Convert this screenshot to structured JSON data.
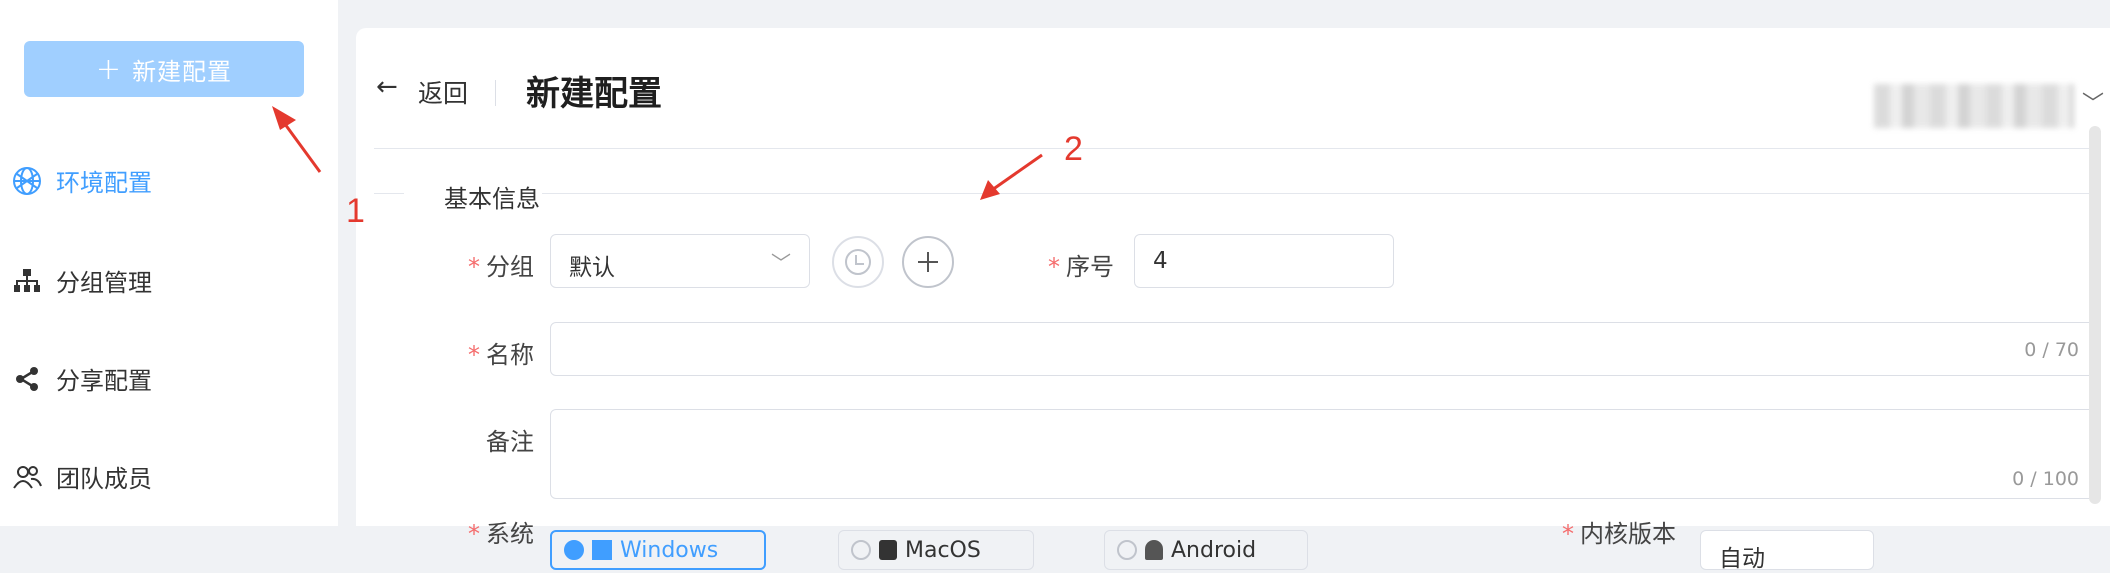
{
  "sidebar": {
    "new_button_label": "新建配置",
    "items": [
      {
        "label": "环境配置",
        "icon": "globe-icon",
        "active": true
      },
      {
        "label": "分组管理",
        "icon": "hierarchy-icon",
        "active": false
      },
      {
        "label": "分享配置",
        "icon": "share-icon",
        "active": false
      },
      {
        "label": "团队成员",
        "icon": "team-icon",
        "active": false
      }
    ]
  },
  "header": {
    "back_label": "返回",
    "title": "新建配置"
  },
  "form": {
    "section_title": "基本信息",
    "group": {
      "label": "分组",
      "value": "默认"
    },
    "serial": {
      "label": "序号",
      "value": "4"
    },
    "name": {
      "label": "名称",
      "value": "",
      "count": "0 / 70"
    },
    "remark": {
      "label": "备注",
      "value": "",
      "count": "0 / 100"
    },
    "system": {
      "label": "系统",
      "options": [
        "Windows",
        "MacOS",
        "Android"
      ],
      "selected": "Windows"
    },
    "kernel": {
      "label": "内核版本",
      "value": "自动"
    }
  },
  "annotations": [
    "1",
    "2"
  ],
  "colors": {
    "accent": "#409eff",
    "accent_light": "#a0cfff",
    "required": "#f56c6c",
    "annotation": "#e4392e"
  }
}
